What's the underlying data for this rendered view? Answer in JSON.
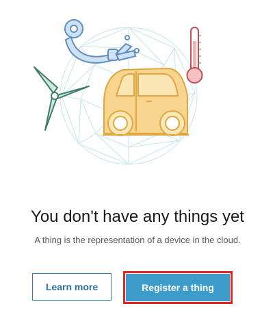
{
  "empty_state": {
    "title": "You don't have any things yet",
    "description": "A thing is the representation of a device in the cloud."
  },
  "actions": {
    "learn_more_label": "Learn more",
    "register_label": "Register a thing"
  },
  "illustration": {
    "icons": [
      "robot-arm-icon",
      "wind-turbine-icon",
      "car-icon",
      "thermometer-icon",
      "geodesic-globe-icon"
    ]
  },
  "colors": {
    "title": "#16191f",
    "description": "#545b64",
    "learn_more_border": "#2f7fa6",
    "register_background": "#3d9cc9",
    "highlight_border": "#e0261e",
    "car_fill": "#f7d58e",
    "turbine": "#5aa589",
    "robot_arm": "#8ab6dc",
    "thermometer": "#e9868a"
  }
}
